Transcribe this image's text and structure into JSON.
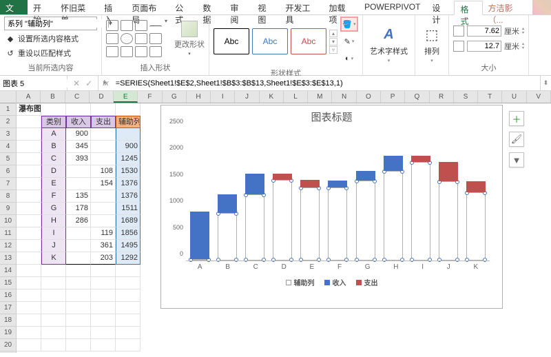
{
  "tabs": {
    "file": "文件",
    "items": [
      "开始",
      "怀旧菜单",
      "插入",
      "页面布局",
      "公式",
      "数据",
      "审阅",
      "视图",
      "开发工具",
      "加载项",
      "POWERPIVOT",
      "设计",
      "格式"
    ],
    "active_index": 12,
    "user": "方洁影（..."
  },
  "ribbon": {
    "selection": {
      "combo_value": "系列 \"辅助列\"",
      "fmt_sel": "设置所选内容格式",
      "reset": "重设以匹配样式",
      "group_label": "当前所选内容"
    },
    "shapes": {
      "change_shape": "更改形状",
      "group_label": "插入形状"
    },
    "shape_styles": {
      "sample": "Abc",
      "group_label": "形状样式"
    },
    "wordart": {
      "label": "艺术字样式"
    },
    "arrange": {
      "label": "排列"
    },
    "size": {
      "height": "7.62",
      "width": "12.7",
      "unit": "厘米",
      "group_label": "大小"
    }
  },
  "formula_bar": {
    "name_box": "图表 5",
    "formula": "=SERIES(Sheet1!$E$2,Sheet1!$B$3:$B$13,Sheet1!$E$3:$E$13,1)"
  },
  "columns": [
    "A",
    "B",
    "C",
    "D",
    "E",
    "F",
    "G",
    "H",
    "I",
    "J",
    "K",
    "L",
    "M",
    "N",
    "O",
    "P",
    "Q",
    "R",
    "S",
    "T",
    "U",
    "V"
  ],
  "sheet": {
    "title": "瀑布图",
    "headers": {
      "cat": "类别",
      "in": "收入",
      "out": "支出",
      "aux": "辅助列"
    },
    "rows": [
      {
        "cat": "A",
        "in": 900,
        "out": "",
        "aux": ""
      },
      {
        "cat": "B",
        "in": 345,
        "out": "",
        "aux": 900
      },
      {
        "cat": "C",
        "in": 393,
        "out": "",
        "aux": 1245
      },
      {
        "cat": "D",
        "in": "",
        "out": 108,
        "aux": 1530
      },
      {
        "cat": "E",
        "in": "",
        "out": 154,
        "aux": 1376
      },
      {
        "cat": "F",
        "in": 135,
        "out": "",
        "aux": 1376
      },
      {
        "cat": "G",
        "in": 178,
        "out": "",
        "aux": 1511
      },
      {
        "cat": "H",
        "in": 286,
        "out": "",
        "aux": 1689
      },
      {
        "cat": "I",
        "in": "",
        "out": 119,
        "aux": 1856
      },
      {
        "cat": "J",
        "in": "",
        "out": 361,
        "aux": 1495
      },
      {
        "cat": "K",
        "in": "",
        "out": 203,
        "aux": 1292
      }
    ]
  },
  "chart_data": {
    "type": "bar",
    "title": "图表标题",
    "categories": [
      "A",
      "B",
      "C",
      "D",
      "E",
      "F",
      "G",
      "H",
      "I",
      "J",
      "K"
    ],
    "series": [
      {
        "name": "辅助列",
        "values": [
          0,
          900,
          1245,
          1530,
          1376,
          1376,
          1511,
          1689,
          1856,
          1495,
          1292
        ],
        "color": "transparent"
      },
      {
        "name": "收入",
        "values": [
          900,
          345,
          393,
          0,
          0,
          135,
          178,
          286,
          0,
          0,
          0
        ],
        "color": "#4472c4"
      },
      {
        "name": "支出",
        "values": [
          0,
          0,
          0,
          108,
          154,
          0,
          0,
          0,
          119,
          361,
          203
        ],
        "color": "#c0504d"
      }
    ],
    "ylabel": "",
    "xlabel": "",
    "ylim": [
      0,
      2500
    ],
    "yticks": [
      0,
      500,
      1000,
      1500,
      2000,
      2500
    ],
    "legend": [
      "辅助列",
      "收入",
      "支出"
    ]
  },
  "side_buttons": [
    "+",
    "brush",
    "filter"
  ]
}
